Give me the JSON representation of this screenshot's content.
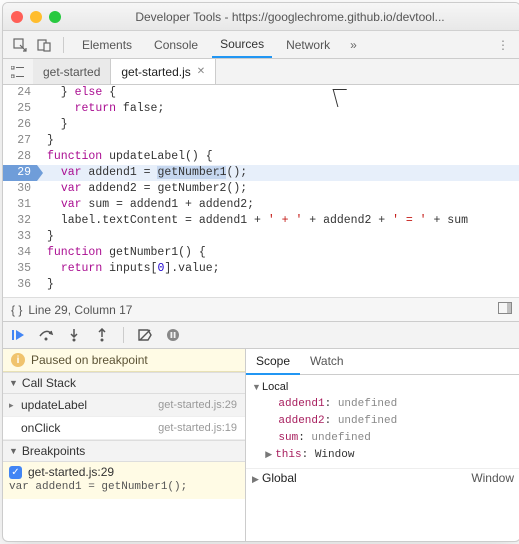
{
  "window": {
    "title": "Developer Tools - https://googlechrome.github.io/devtool..."
  },
  "mainTabs": {
    "items": [
      "Elements",
      "Console",
      "Sources",
      "Network"
    ],
    "activeIndex": 2,
    "moreGlyph": "»"
  },
  "fileTabs": {
    "items": [
      {
        "name": "get-started",
        "active": false,
        "closable": false
      },
      {
        "name": "get-started.js",
        "active": true,
        "closable": true
      }
    ]
  },
  "editor": {
    "executionLine": 29,
    "lines": [
      {
        "n": 24,
        "kw": "",
        "pre": "  } ",
        "kw2": "else",
        "post": " {",
        "value_kw": "",
        "value": ""
      },
      {
        "n": 25,
        "kw": "",
        "pre": "    ",
        "kw2": "return",
        "post": " false;",
        "value_kw": "",
        "value": ""
      },
      {
        "n": 26,
        "kw": "",
        "pre": "  }",
        "kw2": "",
        "post": "",
        "value_kw": "",
        "value": ""
      },
      {
        "n": 27,
        "kw": "",
        "pre": "}",
        "kw2": "",
        "post": "",
        "value_kw": "",
        "value": ""
      },
      {
        "n": 28,
        "kw": "function",
        "pre": "",
        "kw2": "",
        "post": " updateLabel() {",
        "value_kw": "",
        "value": ""
      },
      {
        "n": 29,
        "kw": "",
        "pre": "  ",
        "kw2": "var",
        "post": " addend1 = ",
        "value_kw": "getNumber1",
        "value": "();"
      },
      {
        "n": 30,
        "kw": "",
        "pre": "  ",
        "kw2": "var",
        "post": " addend2 = getNumber2();",
        "value_kw": "",
        "value": ""
      },
      {
        "n": 31,
        "kw": "",
        "pre": "  ",
        "kw2": "var",
        "post": " sum = addend1 + addend2;",
        "value_kw": "",
        "value": ""
      },
      {
        "n": 32,
        "kw": "",
        "pre": "  label.textContent = addend1 + ",
        "kw2": "",
        "post": "",
        "str": "' + '",
        "post2": " + addend2 + ",
        "str2": "' = '",
        "post3": " + sum"
      },
      {
        "n": 33,
        "kw": "",
        "pre": "}",
        "kw2": "",
        "post": "",
        "value_kw": "",
        "value": ""
      },
      {
        "n": 34,
        "kw": "function",
        "pre": "",
        "kw2": "",
        "post": " getNumber1() {",
        "value_kw": "",
        "value": ""
      },
      {
        "n": 35,
        "kw": "",
        "pre": "  ",
        "kw2": "return",
        "post": " inputs[",
        "num": "0",
        "post2": "].value;"
      },
      {
        "n": 36,
        "kw": "",
        "pre": "}",
        "kw2": "",
        "post": "",
        "value_kw": "",
        "value": ""
      }
    ]
  },
  "statusLine": {
    "text": "Line 29, Column 17",
    "bracesGlyph": "{ }"
  },
  "pauseBanner": {
    "text": "Paused on breakpoint"
  },
  "callStack": {
    "title": "Call Stack",
    "items": [
      {
        "fn": "updateLabel",
        "loc": "get-started.js:29",
        "selected": true
      },
      {
        "fn": "onClick",
        "loc": "get-started.js:19",
        "selected": false
      }
    ]
  },
  "breakpoints": {
    "title": "Breakpoints",
    "items": [
      {
        "label": "get-started.js:29",
        "checked": true,
        "code": "var addend1 = getNumber1();"
      }
    ]
  },
  "rightTabs": {
    "items": [
      "Scope",
      "Watch"
    ],
    "activeIndex": 0
  },
  "scope": {
    "localLabel": "Local",
    "locals": [
      {
        "name": "addend1",
        "value": "undefined"
      },
      {
        "name": "addend2",
        "value": "undefined"
      },
      {
        "name": "sum",
        "value": "undefined"
      }
    ],
    "thisLabel": "this",
    "thisValue": "Window",
    "globalLabel": "Global",
    "globalValue": "Window"
  }
}
